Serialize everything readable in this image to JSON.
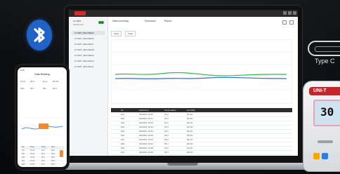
{
  "laptop": {
    "app": {
      "sidebar": {
        "title": "UT-330T",
        "subtitle": "Dashboard",
        "items": [
          "UT330T_BKG04E05",
          "UT330T_BKG04E06",
          "UT330T_BKG04E07",
          "UT330T_BKG04E08",
          "UT330T_BKG04E09",
          "UT330T_BKG04E10",
          "UT330T_BKG04E11"
        ]
      },
      "toolbar": {
        "btn1": "Data recording",
        "btn2": "Download",
        "btn3": "Report"
      },
      "tabs": [
        "Table",
        "Chart"
      ],
      "table": {
        "headers": [
          "No.",
          "Date/Time",
          "Temperature",
          "Humidity"
        ],
        "rows": [
          [
            "001",
            "2023/6/1 15:00",
            "25.0",
            "60.0%"
          ],
          [
            "002",
            "2023/6/1 15:01",
            "25.0",
            "60.0%"
          ],
          [
            "003",
            "2023/6/1 15:02",
            "25.1",
            "60.1%"
          ],
          [
            "004",
            "2023/6/1 15:03",
            "25.0",
            "60.0%"
          ],
          [
            "005",
            "2023/6/1 15:04",
            "25.1",
            "59.9%"
          ],
          [
            "006",
            "2023/6/1 15:05",
            "25.0",
            "60.0%"
          ],
          [
            "007",
            "2023/6/1 15:06",
            "25.0",
            "60.1%"
          ],
          [
            "008",
            "2023/6/1 15:07",
            "25.1",
            "60.0%"
          ],
          [
            "009",
            "2023/6/1 15:08",
            "25.0",
            "60.0%"
          ],
          [
            "010",
            "2023/6/1 15:09",
            "25.0",
            "59.9%"
          ],
          [
            "011",
            "2023/6/1 15:10",
            "25.0",
            "60.0%"
          ],
          [
            "012",
            "2023/6/1 15:11",
            "25.1",
            "60.0%"
          ]
        ]
      }
    }
  },
  "phone": {
    "status": "9:41",
    "title": "Data Reading",
    "rows": [
      [
        "Temp",
        "25.0",
        "Hum",
        "60.0%"
      ],
      [
        "Max",
        "26.1",
        "Min",
        "24.3"
      ]
    ],
    "list_headers": [
      "No.",
      "Time",
      "Temp",
      "Hum"
    ],
    "list_rows": [
      [
        "001",
        "15:00",
        "25.0",
        "60%"
      ],
      [
        "002",
        "15:01",
        "25.0",
        "60%"
      ],
      [
        "003",
        "15:02",
        "25.1",
        "60%"
      ],
      [
        "004",
        "15:03",
        "25.0",
        "60%"
      ],
      [
        "005",
        "15:04",
        "25.1",
        "59%"
      ]
    ]
  },
  "typec": {
    "label": "Type C"
  },
  "device": {
    "brand": "UNI-T",
    "reading": "30"
  },
  "icons": {
    "bluetooth": "bluetooth-icon"
  },
  "colors": {
    "bluetooth_bg": "#1f63c8",
    "accent_red": "#c8252b",
    "series_green": "#2fbf44",
    "series_blue": "#2b6fe0",
    "phone_orange": "#f28b30"
  }
}
